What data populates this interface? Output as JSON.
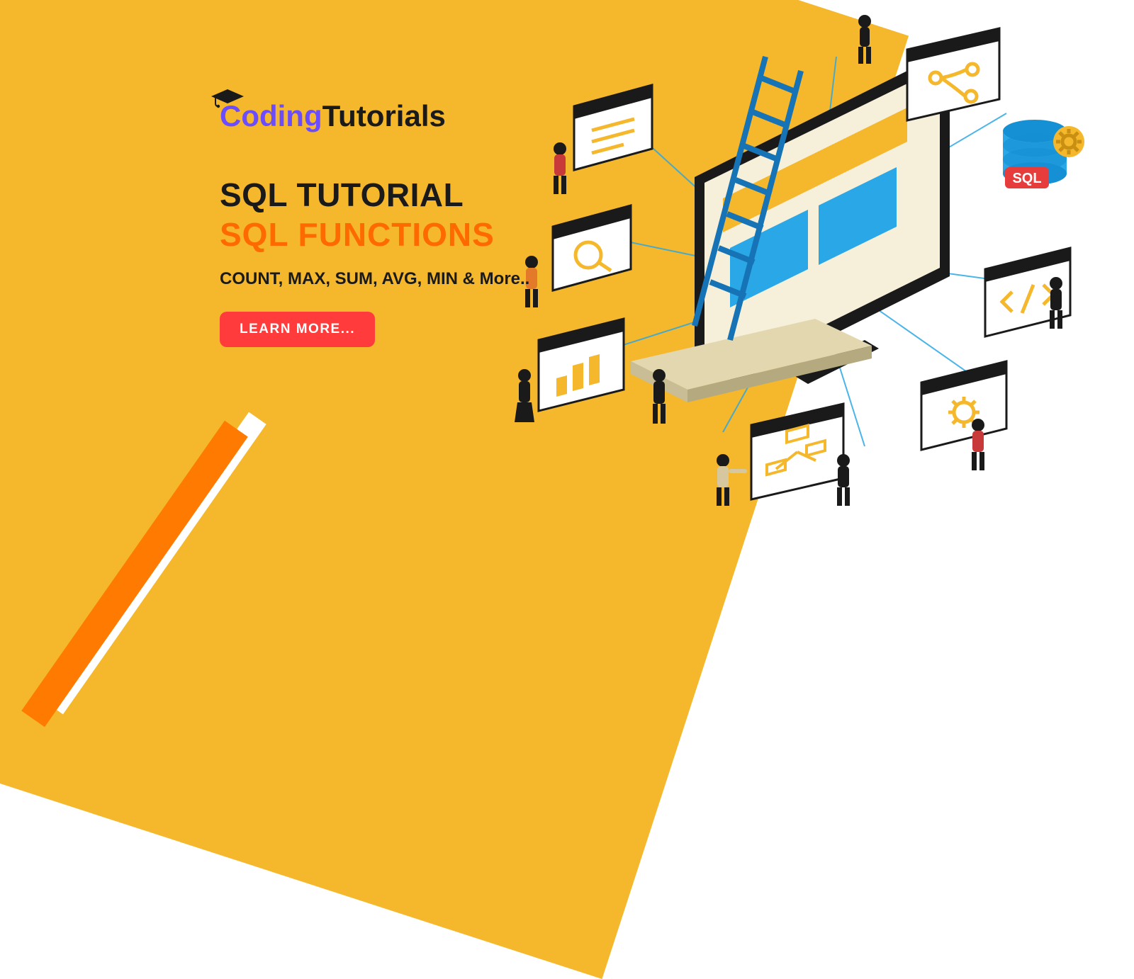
{
  "logo": {
    "part1": "Coding",
    "part2": "Tutorials"
  },
  "title": {
    "line1": "SQL TUTORIAL",
    "line2": "SQL FUNCTIONS"
  },
  "subtitle": "COUNT, MAX, SUM, AVG, MIN & More..",
  "button_label": "LEARN MORE...",
  "badge": {
    "label": "SQL"
  },
  "colors": {
    "yellow": "#f5b72b",
    "orange": "#ff6a00",
    "red": "#ff3b3b",
    "purple": "#6b4cff",
    "dark": "#1a1a1a"
  }
}
